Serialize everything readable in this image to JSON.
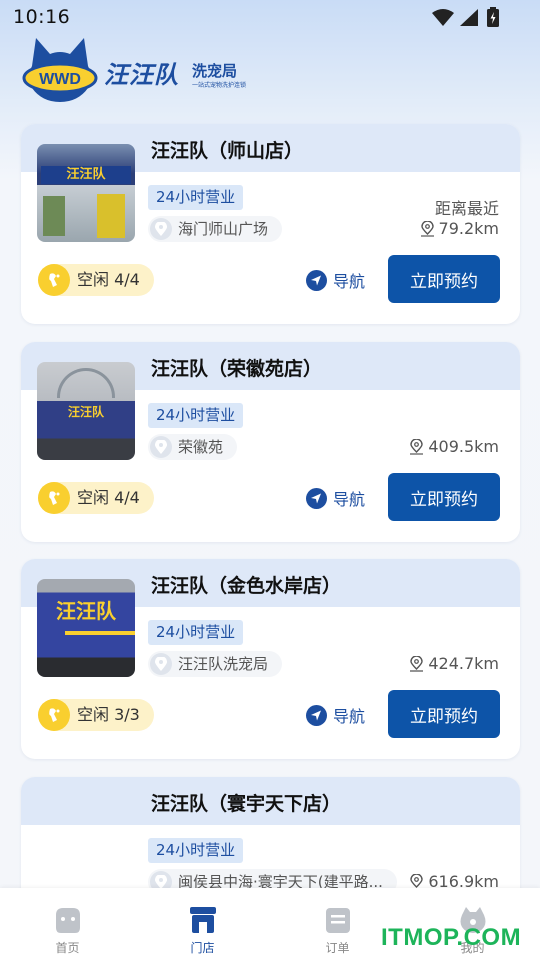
{
  "status_bar": {
    "time": "10:16"
  },
  "header": {
    "logo_mark": "WWD",
    "brand_name": "汪汪队",
    "brand_suffix": "洗宠局",
    "tagline": "一站式宠物洗护连锁"
  },
  "stores": [
    {
      "name": "汪汪队（师山店）",
      "hours": "24小时营业",
      "address": "海门师山广场",
      "nearest_label": "距离最近",
      "distance": "79.2km",
      "idle": "空闲 4/4",
      "nav_label": "导航",
      "book_label": "立即预约",
      "photo_sign": "汪汪队"
    },
    {
      "name": "汪汪队（荣徽苑店）",
      "hours": "24小时营业",
      "address": "荣徽苑",
      "distance": "409.5km",
      "idle": "空闲 4/4",
      "nav_label": "导航",
      "book_label": "立即预约",
      "photo_sign": "汪汪队"
    },
    {
      "name": "汪汪队（金色水岸店）",
      "hours": "24小时营业",
      "address": "汪汪队洗宠局",
      "distance": "424.7km",
      "idle": "空闲 3/3",
      "nav_label": "导航",
      "book_label": "立即预约",
      "photo_sign": "汪汪队"
    },
    {
      "name": "汪汪队（寰宇天下店）",
      "hours": "24小时营业",
      "address": "闽侯县中海·寰宇天下(建平路...",
      "distance": "616.9km"
    }
  ],
  "tab_bar": {
    "tabs": [
      {
        "label": "首页",
        "icon": "home-icon"
      },
      {
        "label": "门店",
        "icon": "store-icon",
        "active": true
      },
      {
        "label": "订单",
        "icon": "order-icon"
      },
      {
        "label": "我的",
        "icon": "profile-icon"
      }
    ]
  },
  "watermark": "ITMOP.COM",
  "colors": {
    "brand_blue": "#0d54a8",
    "idle_yellow": "#f9cf2f",
    "watermark_green": "#1db45a"
  }
}
